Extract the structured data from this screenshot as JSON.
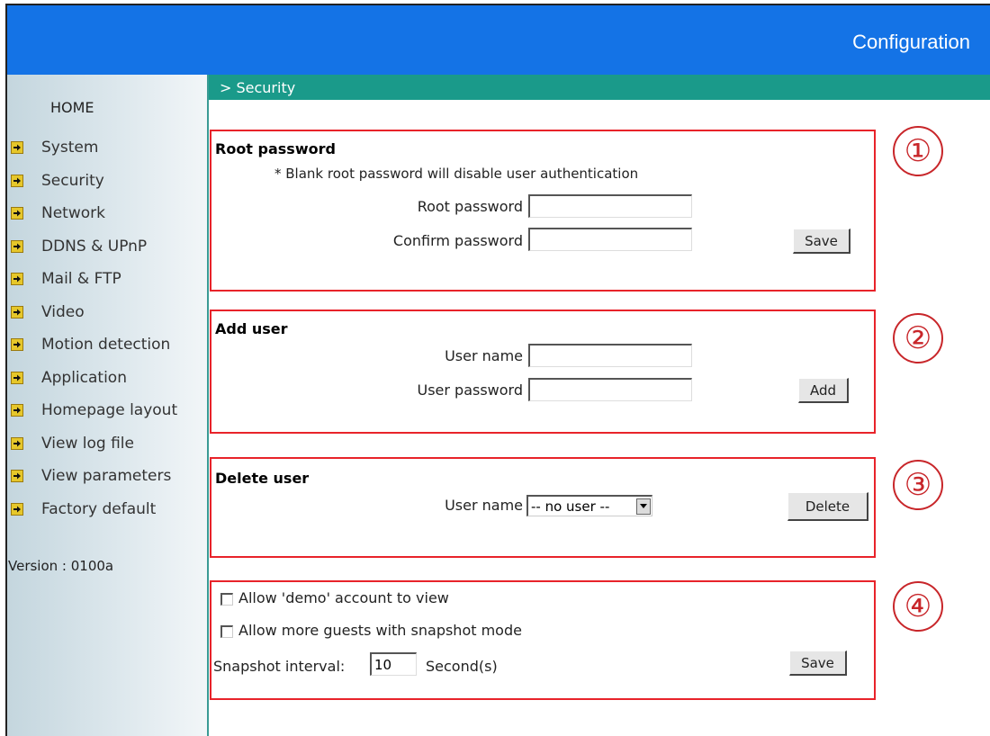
{
  "header": {
    "title": "Configuration"
  },
  "sidebar": {
    "home": "HOME",
    "items": [
      {
        "label": "System",
        "icon": "arrow-right-icon"
      },
      {
        "label": "Security",
        "icon": "arrow-right-icon"
      },
      {
        "label": "Network",
        "icon": "arrow-right-icon"
      },
      {
        "label": "DDNS & UPnP",
        "icon": "arrow-right-icon"
      },
      {
        "label": "Mail & FTP",
        "icon": "arrow-right-icon"
      },
      {
        "label": "Video",
        "icon": "arrow-right-icon"
      },
      {
        "label": "Motion detection",
        "icon": "arrow-right-icon"
      },
      {
        "label": "Application",
        "icon": "arrow-right-icon"
      },
      {
        "label": "Homepage layout",
        "icon": "arrow-right-icon"
      },
      {
        "label": "View log file",
        "icon": "arrow-right-icon"
      },
      {
        "label": "View parameters",
        "icon": "arrow-right-icon"
      },
      {
        "label": "Factory default",
        "icon": "arrow-right-icon"
      }
    ],
    "version": "Version : 0100a"
  },
  "breadcrumb": "> Security",
  "colors": {
    "header": "#1473e6",
    "breadcrumb_bar": "#1a9a8a",
    "section_border": "#e8232a",
    "circle": "#c8262a"
  },
  "sections": {
    "root_password": {
      "number": "①",
      "title": "Root password",
      "note": "* Blank root password will disable user authentication",
      "root_label": "Root password",
      "root_value": "",
      "confirm_label": "Confirm password",
      "confirm_value": "",
      "save_label": "Save"
    },
    "add_user": {
      "number": "②",
      "title": "Add user",
      "username_label": "User name",
      "username_value": "",
      "password_label": "User password",
      "password_value": "",
      "add_label": "Add"
    },
    "delete_user": {
      "number": "③",
      "title": "Delete user",
      "username_label": "User name",
      "selected": "-- no user --",
      "delete_label": "Delete"
    },
    "options": {
      "number": "④",
      "demo_label": "Allow 'demo' account to view",
      "demo_checked": false,
      "guests_label": "Allow more guests with snapshot mode",
      "guests_checked": false,
      "interval_label": "Snapshot interval:",
      "interval_value": "10",
      "interval_unit": "Second(s)",
      "save_label": "Save"
    }
  }
}
